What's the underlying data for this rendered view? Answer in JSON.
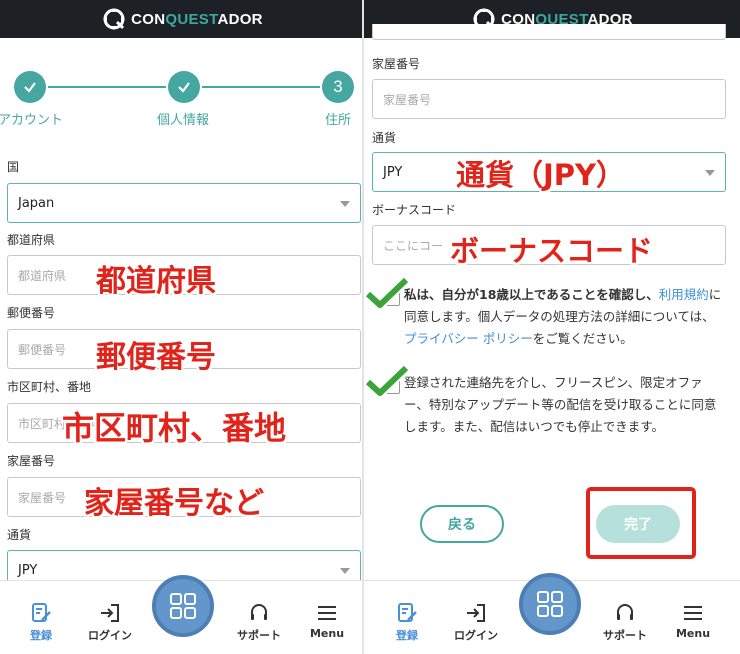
{
  "brand": {
    "logo_text_a": "CON",
    "logo_text_b": "QUEST",
    "logo_text_c": "ADOR",
    "accent": "#3aa9a3",
    "topbar_bg": "#1d2125"
  },
  "stepper": {
    "steps": [
      {
        "label": "アカウント",
        "state": "done"
      },
      {
        "label": "個人情報",
        "state": "done"
      },
      {
        "label": "住所",
        "state": "current",
        "number": "3"
      }
    ]
  },
  "left_form": {
    "country_label": "国",
    "country_value": "Japan",
    "prefecture_label": "都道府県",
    "prefecture_placeholder": "都道府県",
    "postal_label": "郵便番号",
    "postal_placeholder": "郵便番号",
    "city_label": "市区町村、番地",
    "city_placeholder": "市区町村、番地",
    "house_label": "家屋番号",
    "house_placeholder": "家屋番号",
    "currency_label": "通貨",
    "currency_value": "JPY"
  },
  "left_annotations": {
    "prefecture": "都道府県",
    "postal": "郵便番号",
    "city": "市区町村、番地",
    "house": "家屋番号など"
  },
  "right_form": {
    "house_label": "家屋番号",
    "house_placeholder": "家屋番号",
    "currency_label": "通貨",
    "currency_value": "JPY",
    "bonus_label": "ボーナスコード",
    "bonus_placeholder": "ここにコー"
  },
  "right_annotations": {
    "currency": "通貨（JPY）",
    "bonus": "ボーナスコード"
  },
  "consent": {
    "age_bold": "私は、自分が18歳以上であることを確認し、",
    "terms_link": "利用規約",
    "age_rest_1": "に同意します。個人データの処理方法の詳細については、",
    "privacy_link": "プライバシー ポリシー",
    "age_rest_2": "をご覧ください。",
    "marketing_text": "登録された連絡先を介し、フリースピン、限定オファー、特別なアップデート等の配信を受け取ることに同意します。また、配信はいつでも停止できます。"
  },
  "buttons": {
    "back": "戻る",
    "done": "完了"
  },
  "bottom_nav": {
    "register": "登録",
    "login": "ログイン",
    "support": "サポート",
    "menu": "Menu"
  },
  "colors": {
    "teal": "#45a7a0",
    "link": "#3d8fd4",
    "annotation_red": "#e2231a",
    "fab": "#6397cc"
  }
}
